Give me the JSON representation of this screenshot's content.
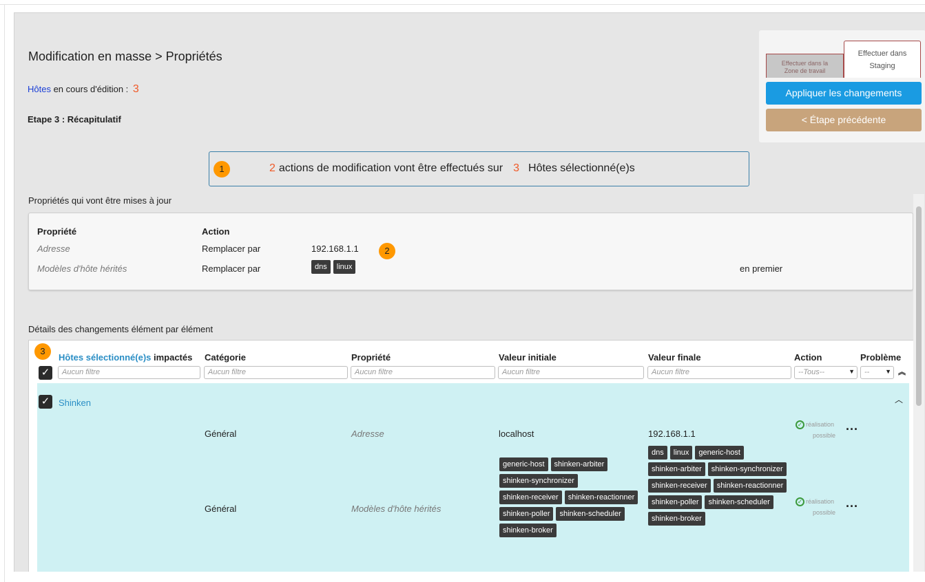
{
  "header": {
    "title": "Modification en masse > Propriétés",
    "editing_link": "Hôtes",
    "editing_text": " en cours d'édition :",
    "editing_count": "3",
    "step": "Etape 3 : Récapitulatif"
  },
  "panel": {
    "tab_work_line1": "Effectuer dans la",
    "tab_work_line2": "Zone de travail",
    "tab_staging_line1": "Effectuer dans",
    "tab_staging_line2": "Staging",
    "apply_label": "Appliquer les changements",
    "prev_label": "< Étape précédente"
  },
  "summary": {
    "badge": "1",
    "count_actions": "2",
    "text1": "actions de modification vont être effectués sur",
    "count_hosts": "3",
    "text2": "Hôtes sélectionné(e)s"
  },
  "properties": {
    "section_label": "Propriétés qui vont être mises à jour",
    "header_property": "Propriété",
    "header_action": "Action",
    "badge": "2",
    "rows": [
      {
        "property": "Adresse",
        "action": "Remplacer par",
        "value": "192.168.1.1"
      },
      {
        "property": "Modèles d'hôte hérités",
        "action": "Remplacer par",
        "tags": [
          "dns",
          "linux"
        ],
        "position": "en premier"
      }
    ]
  },
  "details": {
    "section_label": "Détails des changements élément par élément",
    "badge": "3",
    "headers": {
      "hosts_link": "Hôtes sélectionné(e)s",
      "hosts_rest": " impactés",
      "category": "Catégorie",
      "property": "Propriété",
      "initial": "Valeur initiale",
      "final": "Valeur finale",
      "action": "Action",
      "problem": "Problème"
    },
    "filter_placeholder": "Aucun filtre",
    "action_filter": "--Tous--",
    "problem_filter": "--",
    "group_name": "Shinken",
    "rows": [
      {
        "category": "Général",
        "property": "Adresse",
        "initial": "localhost",
        "final": "192.168.1.1",
        "status_line1": "réalisation",
        "status_line2": "possible"
      },
      {
        "category": "Général",
        "property": "Modèles d'hôte hérités",
        "initial_tags": [
          "generic-host",
          "shinken-arbiter",
          "shinken-synchronizer",
          "shinken-receiver",
          "shinken-reactionner",
          "shinken-poller",
          "shinken-scheduler",
          "shinken-broker"
        ],
        "final_tags": [
          "dns",
          "linux",
          "generic-host",
          "shinken-arbiter",
          "shinken-synchronizer",
          "shinken-receiver",
          "shinken-reactionner",
          "shinken-poller",
          "shinken-scheduler",
          "shinken-broker"
        ],
        "status_line1": "réalisation",
        "status_line2": "possible"
      }
    ]
  },
  "colors": {
    "apply_button": "#1a9be2",
    "prev_button": "#c8a47c",
    "badge": "#ff9800",
    "highlight_number": "#f05a28",
    "group_background": "#cff1f3"
  }
}
